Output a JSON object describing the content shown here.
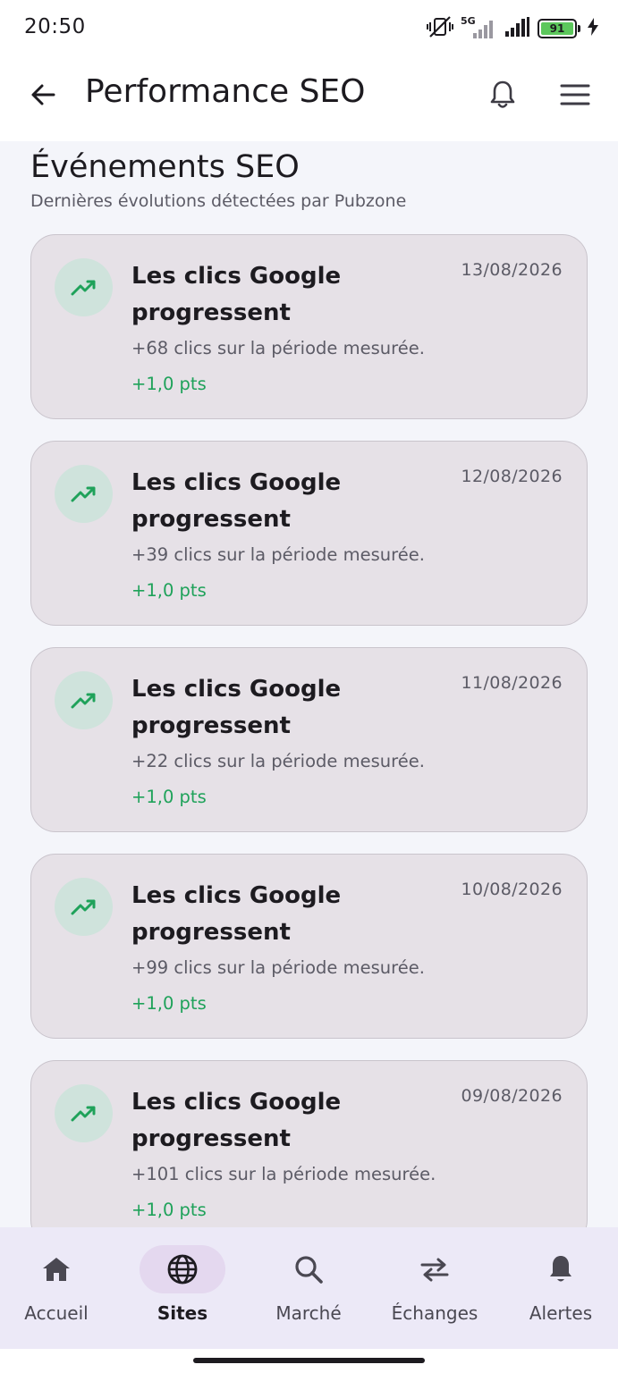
{
  "status_bar": {
    "time": "20:50",
    "battery": "91",
    "network": "5G"
  },
  "app_bar": {
    "title": "Performance SEO"
  },
  "section": {
    "title": "Événements SEO",
    "subtitle": "Dernières évolutions détectées par Pubzone"
  },
  "events": [
    {
      "title": "Les clics Google progressent",
      "date": "13/08/2026",
      "description": "+68 clics sur la période mesurée.",
      "delta": "+1,0 pts"
    },
    {
      "title": "Les clics Google progressent",
      "date": "12/08/2026",
      "description": "+39 clics sur la période mesurée.",
      "delta": "+1,0 pts"
    },
    {
      "title": "Les clics Google progressent",
      "date": "11/08/2026",
      "description": "+22 clics sur la période mesurée.",
      "delta": "+1,0 pts"
    },
    {
      "title": "Les clics Google progressent",
      "date": "10/08/2026",
      "description": "+99 clics sur la période mesurée.",
      "delta": "+1,0 pts"
    },
    {
      "title": "Les clics Google progressent",
      "date": "09/08/2026",
      "description": "+101 clics sur la période mesurée.",
      "delta": "+1,0 pts"
    }
  ],
  "nav": {
    "items": [
      {
        "label": "Accueil",
        "icon": "home-icon"
      },
      {
        "label": "Sites",
        "icon": "globe-icon"
      },
      {
        "label": "Marché",
        "icon": "search-icon"
      },
      {
        "label": "Échanges",
        "icon": "swap-icon"
      },
      {
        "label": "Alertes",
        "icon": "bell-icon"
      }
    ],
    "active": "Sites"
  },
  "colors": {
    "accent_green": "#1fa25a",
    "card_bg": "#e6e1e7",
    "nav_bg": "#ece9f7",
    "nav_active_pill": "#e4d8ef"
  }
}
